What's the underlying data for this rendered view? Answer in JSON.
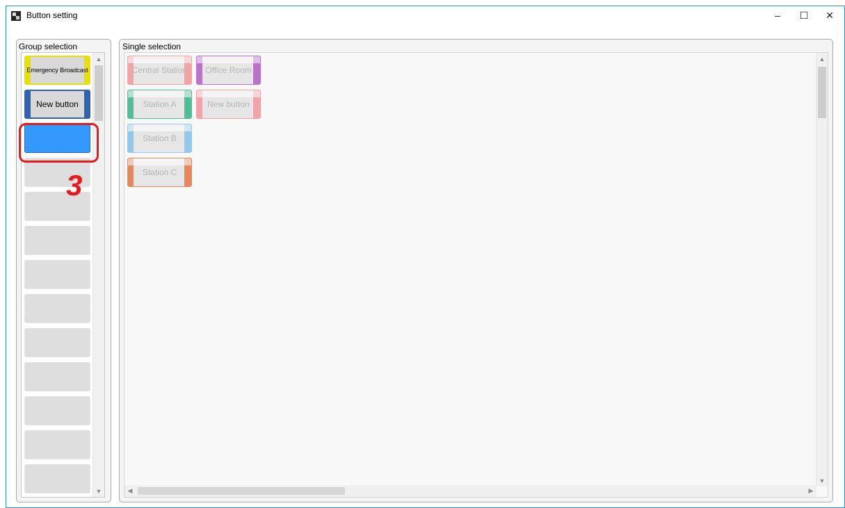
{
  "window": {
    "title": "Button setting",
    "controls": {
      "minimize": "–",
      "maximize": "☐",
      "close": "✕"
    }
  },
  "group_selection": {
    "label": "Group selection",
    "buttons": [
      {
        "label": "Emergency Broadcast",
        "accent": "#e8e000",
        "state": "normal"
      },
      {
        "label": "New button",
        "accent": "#2f62b0",
        "state": "normal"
      },
      {
        "label": "",
        "accent": "#3399ff",
        "state": "selected"
      }
    ],
    "empty_slot_count": 10
  },
  "single_selection": {
    "label": "Single selection",
    "buttons": [
      {
        "label": "Central Station",
        "accent": "#f4a3a3"
      },
      {
        "label": "Office Room",
        "accent": "#b774c8"
      },
      {
        "label": "Station A",
        "accent": "#4fbf98"
      },
      {
        "label": "New button",
        "accent": "#f0a3a8"
      },
      {
        "label": "Station B",
        "accent": "#8fcaee"
      },
      {
        "label": "Station C",
        "accent": "#e8875a"
      }
    ]
  },
  "annotation": {
    "step": "3",
    "color": "#e8191b"
  }
}
